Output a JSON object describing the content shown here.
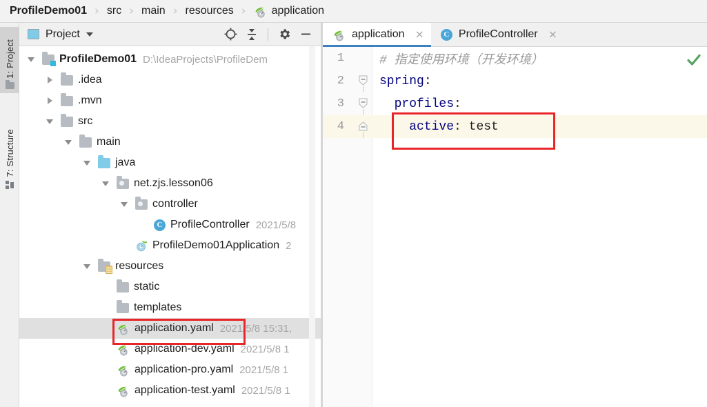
{
  "breadcrumb": {
    "name": "breadcrumb",
    "separator": "›",
    "items": [
      {
        "label": "ProfileDemo01",
        "bold": true,
        "icon": null
      },
      {
        "label": "src",
        "bold": false,
        "icon": null
      },
      {
        "label": "main",
        "bold": false,
        "icon": null
      },
      {
        "label": "resources",
        "bold": false,
        "icon": null
      },
      {
        "label": "application",
        "bold": false,
        "icon": "spring-yaml-icon"
      }
    ]
  },
  "tool_strip": {
    "tabs": [
      {
        "label": "1: Project",
        "icon": "folder-icon",
        "active": true
      },
      {
        "label": "7: Structure",
        "icon": "structure-grid-icon",
        "active": false
      }
    ]
  },
  "project_panel": {
    "title": "Project",
    "title_icon": "project-window-icon",
    "dropdown_icon": "chevron-down-icon",
    "actions": [
      {
        "name": "locate-file-button",
        "icon": "crosshair-icon"
      },
      {
        "name": "collapse-all-button",
        "icon": "collapse-all-icon"
      },
      {
        "name": "settings-button",
        "icon": "gear-icon"
      },
      {
        "name": "hide-button",
        "icon": "minimize-icon"
      }
    ],
    "tree": [
      {
        "label": "ProfileDemo01",
        "meta": "D:\\IdeaProjects\\ProfileDem",
        "depth": 0,
        "twisty": "expanded",
        "icon": "project-folder-icon",
        "bold": true,
        "selected": false
      },
      {
        "label": ".idea",
        "meta": "",
        "depth": 1,
        "twisty": "collapsed",
        "icon": "folder-icon",
        "bold": false,
        "selected": false
      },
      {
        "label": ".mvn",
        "meta": "",
        "depth": 1,
        "twisty": "collapsed",
        "icon": "folder-icon",
        "bold": false,
        "selected": false
      },
      {
        "label": "src",
        "meta": "",
        "depth": 1,
        "twisty": "expanded",
        "icon": "folder-icon",
        "bold": false,
        "selected": false
      },
      {
        "label": "main",
        "meta": "",
        "depth": 2,
        "twisty": "expanded",
        "icon": "folder-icon",
        "bold": false,
        "selected": false
      },
      {
        "label": "java",
        "meta": "",
        "depth": 3,
        "twisty": "expanded",
        "icon": "source-folder-icon",
        "bold": false,
        "selected": false
      },
      {
        "label": "net.zjs.lesson06",
        "meta": "",
        "depth": 4,
        "twisty": "expanded",
        "icon": "package-icon",
        "bold": false,
        "selected": false
      },
      {
        "label": "controller",
        "meta": "",
        "depth": 5,
        "twisty": "expanded",
        "icon": "package-icon",
        "bold": false,
        "selected": false
      },
      {
        "label": "ProfileController",
        "meta": "2021/5/8",
        "depth": 6,
        "twisty": "none",
        "icon": "java-class-icon",
        "bold": false,
        "selected": false
      },
      {
        "label": "ProfileDemo01Application",
        "meta": "2",
        "depth": 5,
        "twisty": "none",
        "icon": "spring-boot-app-icon",
        "bold": false,
        "selected": false
      },
      {
        "label": "resources",
        "meta": "",
        "depth": 3,
        "twisty": "expanded",
        "icon": "resources-folder-icon",
        "bold": false,
        "selected": false
      },
      {
        "label": "static",
        "meta": "",
        "depth": 4,
        "twisty": "none",
        "icon": "folder-icon",
        "bold": false,
        "selected": false
      },
      {
        "label": "templates",
        "meta": "",
        "depth": 4,
        "twisty": "none",
        "icon": "folder-icon",
        "bold": false,
        "selected": false
      },
      {
        "label": "application.yaml",
        "meta": "2021/5/8 15:31,",
        "depth": 4,
        "twisty": "none",
        "icon": "spring-yaml-icon",
        "bold": false,
        "selected": true
      },
      {
        "label": "application-dev.yaml",
        "meta": "2021/5/8 1",
        "depth": 4,
        "twisty": "none",
        "icon": "spring-yaml-icon",
        "bold": false,
        "selected": false
      },
      {
        "label": "application-pro.yaml",
        "meta": "2021/5/8 1",
        "depth": 4,
        "twisty": "none",
        "icon": "spring-yaml-icon",
        "bold": false,
        "selected": false
      },
      {
        "label": "application-test.yaml",
        "meta": "2021/5/8 1",
        "depth": 4,
        "twisty": "none",
        "icon": "spring-yaml-icon",
        "bold": false,
        "selected": false
      }
    ]
  },
  "editor": {
    "tabs": [
      {
        "label": "application",
        "icon": "spring-yaml-icon",
        "active": true,
        "close": "×"
      },
      {
        "label": "ProfileController",
        "icon": "java-class-icon",
        "active": false,
        "close": "×"
      }
    ],
    "inspection_status_icon": "green-check-icon",
    "lines": [
      {
        "num": "1",
        "fold": "none",
        "highlight": false,
        "tokens": [
          {
            "text": "# ",
            "type": "comment"
          },
          {
            "text": "指定使用环境（开发环境）",
            "type": "comment"
          }
        ]
      },
      {
        "num": "2",
        "fold": "minus",
        "highlight": false,
        "tokens": [
          {
            "text": "spring",
            "type": "key"
          },
          {
            "text": ":",
            "type": "punct"
          }
        ]
      },
      {
        "num": "3",
        "fold": "minus",
        "highlight": false,
        "tokens": [
          {
            "text": "  profiles",
            "type": "key"
          },
          {
            "text": ":",
            "type": "punct"
          }
        ]
      },
      {
        "num": "4",
        "fold": "end",
        "highlight": true,
        "tokens": [
          {
            "text": "    active",
            "type": "key"
          },
          {
            "text": ": ",
            "type": "punct"
          },
          {
            "text": "test",
            "type": "value"
          }
        ]
      }
    ]
  },
  "annotations": [
    {
      "name": "editor-active-profile-highlight",
      "color": "#e8262a"
    },
    {
      "name": "tree-application-yaml-highlight",
      "color": "#e8262a"
    }
  ],
  "colors": {
    "accent_blue": "#3e7fc1",
    "yaml_key": "#000080",
    "comment_gray": "#9a9a9a",
    "annotation_red": "#e8262a",
    "selection_gray": "#e0e0e0",
    "line_highlight": "#fcf8e9"
  }
}
